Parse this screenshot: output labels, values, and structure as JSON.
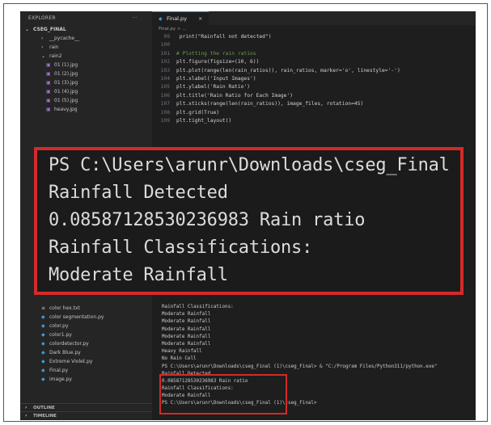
{
  "sidebar": {
    "title": "EXPLORER",
    "more": "···",
    "folder": "CSEG_FINAL",
    "items": [
      {
        "label": "__pycache__",
        "icon": "chevron-right-icon",
        "level": 2
      },
      {
        "label": "rain",
        "icon": "chevron-right-icon",
        "level": 2
      },
      {
        "label": "rain2",
        "icon": "chevron-down-icon",
        "level": 2
      },
      {
        "label": "01 (1).jpg",
        "icon": "image-file-icon",
        "level": 3
      },
      {
        "label": "01 (2).jpg",
        "icon": "image-file-icon",
        "level": 3
      },
      {
        "label": "01 (3).jpg",
        "icon": "image-file-icon",
        "level": 3
      },
      {
        "label": "01 (4).jpg",
        "icon": "image-file-icon",
        "level": 3
      },
      {
        "label": "01 (5).jpg",
        "icon": "image-file-icon",
        "level": 3
      },
      {
        "label": "heavy.jpg",
        "icon": "image-file-icon",
        "level": 3
      }
    ],
    "lower_items": [
      {
        "label": "color hex.txt",
        "icon": "text-file-icon"
      },
      {
        "label": "color segmentation.py",
        "icon": "python-file-icon"
      },
      {
        "label": "color.py",
        "icon": "python-file-icon"
      },
      {
        "label": "color1.py",
        "icon": "python-file-icon"
      },
      {
        "label": "colordetector.py",
        "icon": "python-file-icon"
      },
      {
        "label": "Dark Blue.py",
        "icon": "python-file-icon"
      },
      {
        "label": "Extreme Violet.py",
        "icon": "python-file-icon"
      },
      {
        "label": "Final.py",
        "icon": "python-file-icon"
      },
      {
        "label": "image.py",
        "icon": "python-file-icon"
      }
    ],
    "outline": "OUTLINE",
    "timeline": "TIMELINE"
  },
  "editor": {
    "tab": "Final.py",
    "tab_close": "×",
    "breadcrumb": "Final.py > ...",
    "lines": [
      {
        "num": "99",
        "text": "        print(\"Rainfall not detected\")",
        "comment": false
      },
      {
        "num": "100",
        "text": "",
        "comment": false
      },
      {
        "num": "101",
        "text": "# Plotting the rain ratios",
        "comment": true
      },
      {
        "num": "102",
        "text": "plt.figure(figsize=(10, 6))",
        "comment": false
      },
      {
        "num": "103",
        "text": "plt.plot(range(len(rain_ratios)), rain_ratios, marker='o', linestyle='-')",
        "comment": false
      },
      {
        "num": "104",
        "text": "plt.xlabel('Input Images')",
        "comment": false
      },
      {
        "num": "105",
        "text": "plt.ylabel('Rain Ratio')",
        "comment": false
      },
      {
        "num": "106",
        "text": "plt.title('Rain Ratio for Each Image')",
        "comment": false
      },
      {
        "num": "107",
        "text": "plt.xticks(range(len(rain_ratios)), image_files, rotation=45)",
        "comment": false
      },
      {
        "num": "108",
        "text": "plt.grid(True)",
        "comment": false
      },
      {
        "num": "109",
        "text": "plt.tight_layout()",
        "comment": false
      }
    ]
  },
  "terminal": {
    "lines": [
      "Rainfall Classifications:",
      "Moderate Rainfall",
      "Moderate Rainfall",
      "Moderate Rainfall",
      "Moderate Rainfall",
      "Moderate Rainfall",
      "Heavy Rainfall",
      "No Rain Cell",
      "PS C:\\Users\\arunr\\Downloads\\cseg_Final (1)\\cseg_Final> & \"C:/Program Files/Python311/python.exe\"",
      "Rainfall Detected",
      "0.08587128530236983 Rain ratio",
      "Rainfall Classifications:",
      "Moderate Rainfall",
      "PS C:\\Users\\arunr\\Downloads\\cseg_Final (1)\\cseg_Final>"
    ]
  },
  "zoom": {
    "lines": [
      "PS C:\\Users\\arunr\\Downloads\\cseg_Final",
      "Rainfall Detected",
      "0.08587128530236983 Rain ratio",
      "Rainfall Classifications:",
      "Moderate Rainfall"
    ]
  },
  "colors": {
    "highlight": "#d42a2a",
    "editor_bg": "#1e1e1e",
    "sidebar_bg": "#252526"
  }
}
